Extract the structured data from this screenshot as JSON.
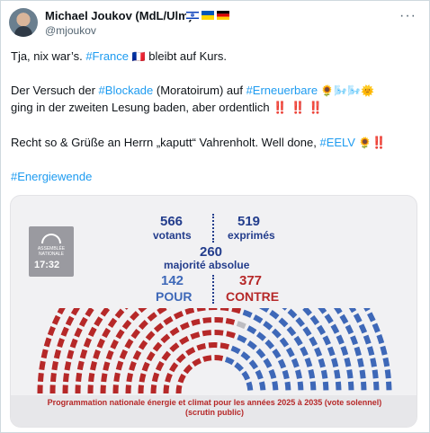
{
  "author": {
    "name": "Michael Joukov (MdL/Ulm)",
    "handle": "@mjoukov",
    "flags": [
      "israel-flag",
      "ukraine-flag",
      "germany-flag"
    ],
    "more_label": "···"
  },
  "text": {
    "line1_pre": "Tja, nix war’s. ",
    "line1_tag": "#France",
    "line1_emoji": "🇫🇷",
    "line1_post": " bleibt auf Kurs.",
    "line2_a": "Der Versuch der ",
    "line2_tag1": "#Blockade",
    "line2_b": " (Moratoirum) auf ",
    "line2_tag2": "#Erneuerbare",
    "line2_emojis": " 🌻🌬️🌬️🌞",
    "line3": "ging in der zweiten Lesung baden, aber ordentlich ",
    "line3_bangs": "‼️ ‼️ ‼️",
    "line4_pre": "Recht so & Grüße an Herrn „kaputt“ Vahrenholt. Well done, ",
    "line4_tag": "#EELV",
    "line4_emoji": " 🌻",
    "line4_bang": "‼️",
    "line5_tag": "#Energiewende"
  },
  "image": {
    "logo_text": "ASSEMBLÉE NATIONALE",
    "time": "17:32",
    "votants_num": "566",
    "votants_lbl": "votants",
    "exprimes_num": "519",
    "exprimes_lbl": "exprimés",
    "majorite_num": "260",
    "majorite_lbl": "majorité absolue",
    "pour_num": "142",
    "pour_lbl": "POUR",
    "contre_num": "377",
    "contre_lbl": "CONTRE",
    "footer_line1": "Programmation nationale énergie et climat pour les années 2025 à 2035 (vote solennel)",
    "footer_line2": "(scrutin public)",
    "colors": {
      "contre": "#b62828",
      "pour": "#3e68b8",
      "abstention": "#bdbdc2",
      "navy": "#233d8c"
    }
  }
}
